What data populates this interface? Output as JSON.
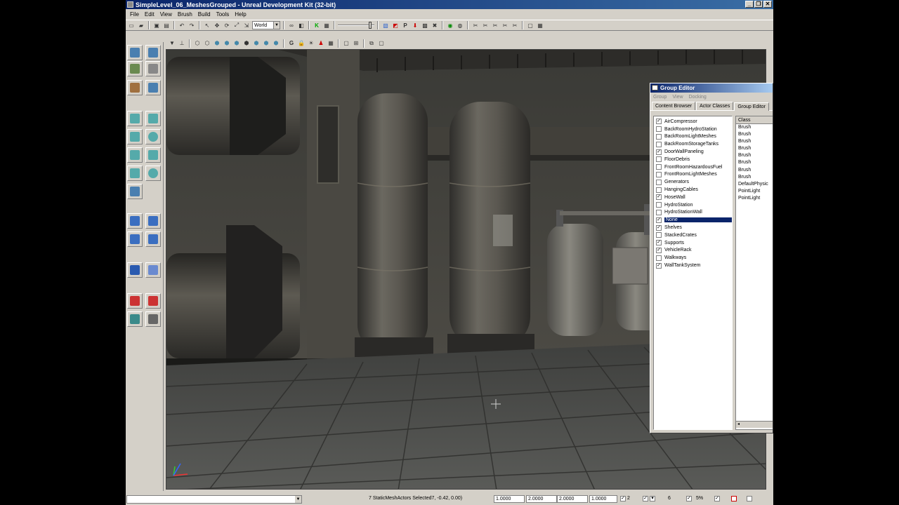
{
  "window": {
    "title": "SimpleLevel_06_MeshesGrouped - Unreal Development Kit (32-bit)"
  },
  "menu": [
    "File",
    "Edit",
    "View",
    "Brush",
    "Build",
    "Tools",
    "Help"
  ],
  "toolbar": {
    "coordinate_system": "World"
  },
  "group_editor": {
    "title": "Group Editor",
    "menu": [
      "Group",
      "View",
      "Docking"
    ],
    "tabs": [
      "Content Browser",
      "Actor Classes",
      "Group Editor"
    ],
    "active_tab": 2,
    "groups": [
      {
        "label": "AirCompressor",
        "checked": true
      },
      {
        "label": "BackRoomHydroStation",
        "checked": false
      },
      {
        "label": "BackRoomLightMeshes",
        "checked": false
      },
      {
        "label": "BackRoomStorageTanks",
        "checked": false
      },
      {
        "label": "DoorWallPaneling",
        "checked": true
      },
      {
        "label": "FloorDebris",
        "checked": false
      },
      {
        "label": "FrontRoomHazardousFuel",
        "checked": false
      },
      {
        "label": "FrontRoomLightMeshes",
        "checked": false
      },
      {
        "label": "Generators",
        "checked": false
      },
      {
        "label": "HangingCables",
        "checked": false
      },
      {
        "label": "HoseWall",
        "checked": true
      },
      {
        "label": "HydroStation",
        "checked": false
      },
      {
        "label": "HydroStationWall",
        "checked": false
      },
      {
        "label": "None",
        "checked": true,
        "selected": true
      },
      {
        "label": "Shelves",
        "checked": true
      },
      {
        "label": "StackedCrates",
        "checked": false
      },
      {
        "label": "Supports",
        "checked": true
      },
      {
        "label": "VehicleRack",
        "checked": true
      },
      {
        "label": "Walkways",
        "checked": false
      },
      {
        "label": "WallTankSystem",
        "checked": true
      }
    ],
    "class_header": "Class",
    "classes": [
      "Brush",
      "Brush",
      "Brush",
      "Brush",
      "Brush",
      "Brush",
      "Brush",
      "Brush",
      "DefaultPhysic",
      "PointLight",
      "PointLight"
    ]
  },
  "statusbar": {
    "message": "7 StaticMeshActors Selected7, -0.42, 0.00)",
    "drag_grid_1": "1.0000",
    "drag_grid_2": "2.0000",
    "drag_grid_3": "2.0000",
    "drag_grid_4": "1.0000",
    "grid_size": "2",
    "rotation_snap": "6",
    "scale_snap": "5%"
  },
  "colors": {
    "title_bar": "#0a246a",
    "selection": "#0a246a",
    "window_face": "#d4d0c8"
  }
}
